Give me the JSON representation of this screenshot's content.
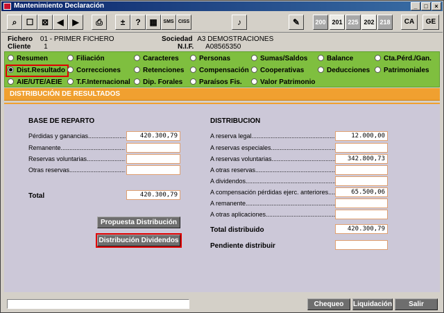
{
  "window": {
    "title": "Mantenimiento Declaración"
  },
  "toolbar": {
    "plus_label": "±",
    "help_label": "?",
    "sms_label": "SMS",
    "ciss_label": "CISS",
    "model_buttons": [
      "200",
      "201",
      "225",
      "202",
      "218"
    ],
    "ca_label": "CA",
    "ge_label": "GE"
  },
  "header": {
    "fichero_label": "Fichero",
    "fichero_value": "01 - PRIMER FICHERO",
    "cliente_label": "Cliente",
    "cliente_value": "1",
    "sociedad_label": "Sociedad",
    "sociedad_value": "A3 DEMOSTRACIONES",
    "nif_label": "N.I.F.",
    "nif_value": "A08565350"
  },
  "options": [
    {
      "label": "Resumen",
      "selected": false
    },
    {
      "label": "Filiación",
      "selected": false
    },
    {
      "label": "Caracteres",
      "selected": false
    },
    {
      "label": "Personas",
      "selected": false
    },
    {
      "label": "Sumas/Saldos",
      "selected": false
    },
    {
      "label": "Balance",
      "selected": false
    },
    {
      "label": "Cta.Pérd./Gan.",
      "selected": false
    },
    {
      "label": "Dist.Resultado",
      "selected": true
    },
    {
      "label": "Correcciones",
      "selected": false
    },
    {
      "label": "Retenciones",
      "selected": false
    },
    {
      "label": "Compensación",
      "selected": false
    },
    {
      "label": "Cooperativas",
      "selected": false
    },
    {
      "label": "Deducciones",
      "selected": false
    },
    {
      "label": "Patrimoniales",
      "selected": false
    },
    {
      "label": "AIE/UTE/AEIE",
      "selected": false
    },
    {
      "label": "T.F.Internacional",
      "selected": false
    },
    {
      "label": "Dip. Forales",
      "selected": false
    },
    {
      "label": "Paraísos Fis.",
      "selected": false
    },
    {
      "label": "Valor Patrimonio",
      "selected": false
    }
  ],
  "section_title": "DISTRIBUCIÓN DE RESULTADOS",
  "base": {
    "title": "BASE DE REPARTO",
    "rows": [
      {
        "label": "Pérdidas y ganancias",
        "value": "420.300,79"
      },
      {
        "label": "Remanente",
        "value": ""
      },
      {
        "label": "Reservas voluntarias",
        "value": ""
      },
      {
        "label": "Otras reservas",
        "value": ""
      }
    ],
    "total_label": "Total",
    "total_value": "420.300,79"
  },
  "distribucion": {
    "title": "DISTRIBUCIÓN",
    "rows": [
      {
        "label": "A reserva legal",
        "value": "12.000,00"
      },
      {
        "label": "A reservas especiales",
        "value": ""
      },
      {
        "label": "A reservas voluntarias",
        "value": "342.800,73"
      },
      {
        "label": "A otras reservas",
        "value": ""
      },
      {
        "label": "A dividendos",
        "value": ""
      },
      {
        "label": "A compensación pérdidas  ejerc. anteriores",
        "value": "65.500,06"
      },
      {
        "label": "A remanente",
        "value": ""
      },
      {
        "label": "A otras aplicaciones",
        "value": ""
      }
    ],
    "total_label": "Total distribuido",
    "total_value": "420.300,79",
    "pendiente_label": "Pendiente distribuir",
    "pendiente_value": ""
  },
  "actions": {
    "propuesta_label": "Propuesta Distribución",
    "dividendos_label": "Distribución Dividendos"
  },
  "footer": {
    "status_text": "",
    "chequeo_label": "Chequeo",
    "liquidacion_label": "Liquidación",
    "salir_label": "Salir"
  }
}
